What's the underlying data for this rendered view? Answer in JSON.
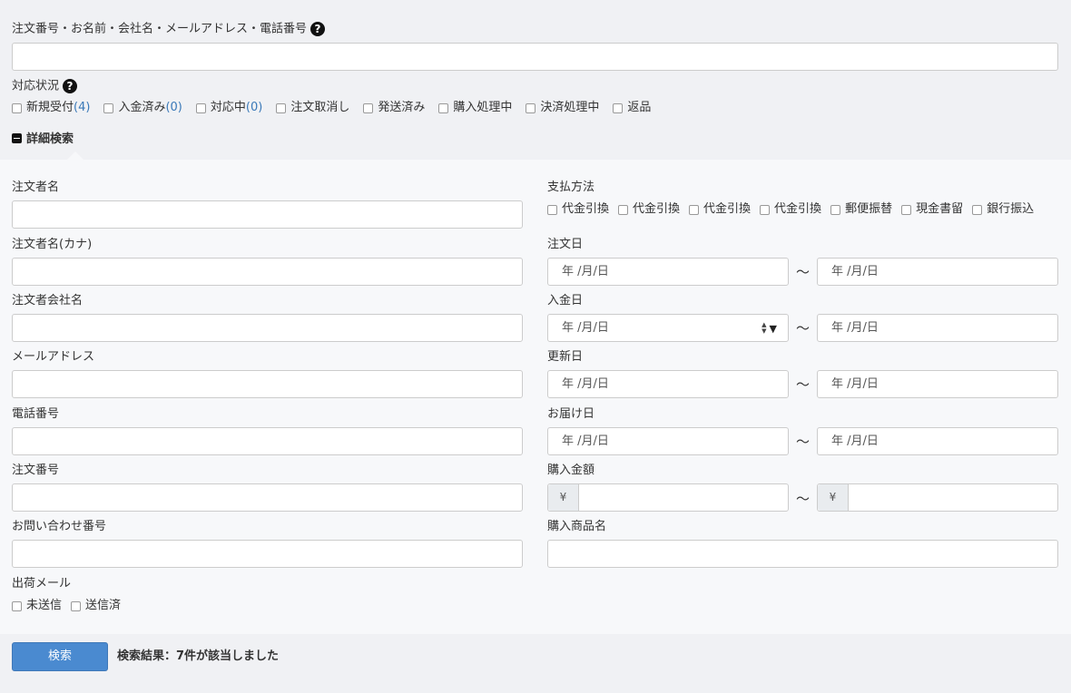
{
  "keyword": {
    "label": "注文番号・お名前・会社名・メールアドレス・電話番号",
    "help": "?",
    "value": ""
  },
  "status": {
    "label": "対応状況",
    "help": "?",
    "items": [
      {
        "label": "新規受付",
        "count": "(4)"
      },
      {
        "label": "入金済み",
        "count": "(0)"
      },
      {
        "label": "対応中",
        "count": "(0)"
      },
      {
        "label": "注文取消し",
        "count": ""
      },
      {
        "label": "発送済み",
        "count": ""
      },
      {
        "label": "購入処理中",
        "count": ""
      },
      {
        "label": "決済処理中",
        "count": ""
      },
      {
        "label": "返品",
        "count": ""
      }
    ]
  },
  "advanced_toggle": "詳細検索",
  "left": {
    "orderer_name": "注文者名",
    "orderer_kana": "注文者名(カナ)",
    "orderer_company": "注文者会社名",
    "email": "メールアドレス",
    "phone": "電話番号",
    "order_number": "注文番号",
    "inquiry_number": "お問い合わせ番号",
    "shipping_mail": {
      "label": "出荷メール",
      "items": [
        "未送信",
        "送信済"
      ]
    }
  },
  "right": {
    "payment": {
      "label": "支払方法",
      "items": [
        "代金引換",
        "代金引換",
        "代金引換",
        "代金引換",
        "郵便振替",
        "現金書留",
        "銀行振込"
      ]
    },
    "order_date": "注文日",
    "payment_date": "入金日",
    "update_date": "更新日",
    "delivery_date": "お届け日",
    "amount": "購入金額",
    "product_name": "購入商品名",
    "date_placeholder": "年 /月/日",
    "tilde": "〜",
    "currency": "¥"
  },
  "search_button": "検索",
  "result_text": "検索結果：7件が該当しました"
}
